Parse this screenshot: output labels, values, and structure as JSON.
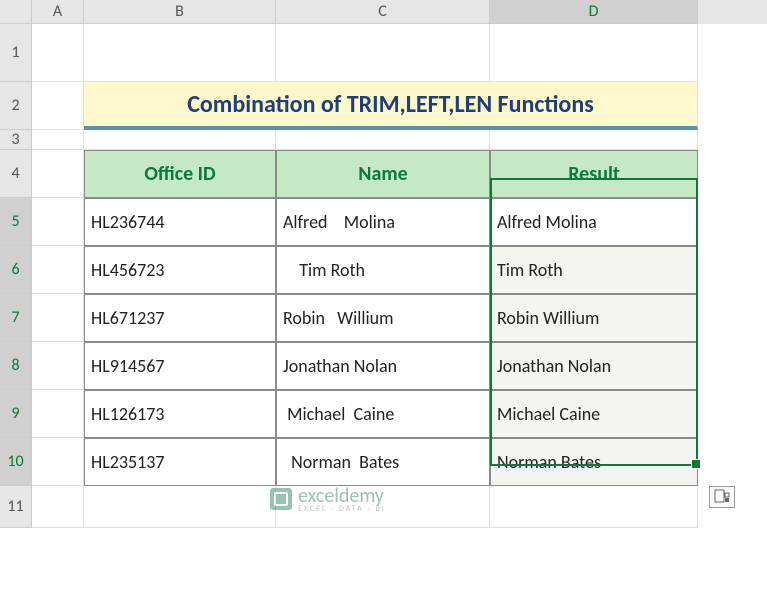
{
  "columns": [
    "A",
    "B",
    "C",
    "D"
  ],
  "row_numbers": [
    "1",
    "2",
    "3",
    "4",
    "5",
    "6",
    "7",
    "8",
    "9",
    "10",
    "11"
  ],
  "title": "Combination of TRIM,LEFT,LEN Functions",
  "headers": {
    "office_id": "Office ID",
    "name": "Name",
    "result": "Result"
  },
  "rows": [
    {
      "office_id": "HL236744",
      "name": "Alfred    Molina",
      "result": "Alfred Molina"
    },
    {
      "office_id": "HL456723",
      "name": "    Tim Roth",
      "result": "Tim Roth"
    },
    {
      "office_id": "HL671237",
      "name": "Robin   Willium",
      "result": "Robin Willium"
    },
    {
      "office_id": "HL914567",
      "name": "Jonathan Nolan",
      "result": "Jonathan Nolan"
    },
    {
      "office_id": "HL126173",
      "name": " Michael  Caine",
      "result": "Michael Caine"
    },
    {
      "office_id": "HL235137",
      "name": "  Norman  Bates",
      "result": "Norman Bates"
    }
  ],
  "watermark": {
    "text": "exceldemy",
    "subtitle": "EXCEL · DATA · BI"
  },
  "chart_data": {
    "type": "table",
    "title": "Combination of TRIM,LEFT,LEN Functions",
    "columns": [
      "Office ID",
      "Name",
      "Result"
    ],
    "data": [
      [
        "HL236744",
        "Alfred    Molina",
        "Alfred Molina"
      ],
      [
        "HL456723",
        "    Tim Roth",
        "Tim Roth"
      ],
      [
        "HL671237",
        "Robin   Willium",
        "Robin Willium"
      ],
      [
        "HL914567",
        "Jonathan Nolan",
        "Jonathan Nolan"
      ],
      [
        "HL126173",
        " Michael  Caine",
        "Michael Caine"
      ],
      [
        "HL235137",
        "  Norman  Bates",
        "Norman Bates"
      ]
    ]
  }
}
